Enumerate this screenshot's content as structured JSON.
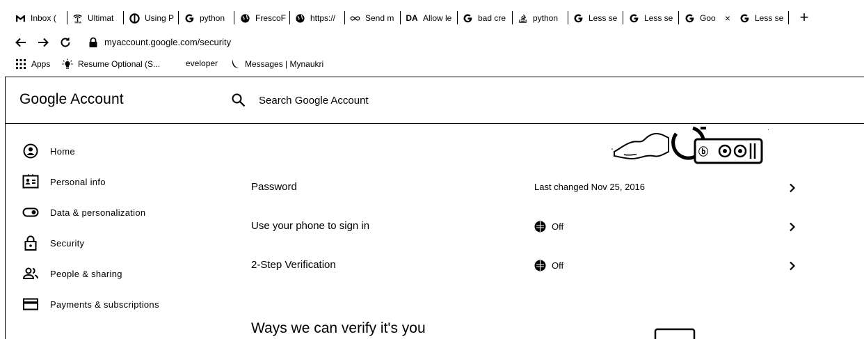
{
  "browser": {
    "tabs": [
      {
        "icon": "gmail-icon",
        "label": "Inbox (",
        "active": false
      },
      {
        "icon": "tata-icon",
        "label": "Ultimat",
        "active": false
      },
      {
        "icon": "circle-logo-icon",
        "label": "Using P",
        "active": false
      },
      {
        "icon": "google-g-icon",
        "label": "python",
        "active": false
      },
      {
        "icon": "globe-icon",
        "label": "FrescoF",
        "active": false
      },
      {
        "icon": "globe-icon",
        "label": "https://",
        "active": false
      },
      {
        "icon": "infinity-icon",
        "label": "Send m",
        "active": false
      },
      {
        "icon": "da-icon",
        "label": "Allow le",
        "active": false
      },
      {
        "icon": "google-g-icon",
        "label": "bad cre",
        "active": false
      },
      {
        "icon": "stack-icon",
        "label": "python",
        "active": false
      },
      {
        "icon": "google-g-icon",
        "label": "Less se",
        "active": false
      },
      {
        "icon": "google-g-icon",
        "label": "Less se",
        "active": false
      },
      {
        "icon": "google-g-icon",
        "label": "Goo",
        "active": true
      },
      {
        "icon": "google-g-icon",
        "label": "Less se",
        "active": false
      }
    ],
    "da_glyph": "DA",
    "close_glyph": "×",
    "newtab_glyph": "+",
    "url": "myaccount.google.com/security",
    "bookmarks": [
      {
        "icon": "apps-grid-icon",
        "label": "Apps"
      },
      {
        "icon": "bulb-icon",
        "label": "Resume Optional (S..."
      },
      {
        "icon": "",
        "label": "eveloper"
      },
      {
        "icon": "moon-icon",
        "label": "Messages | Mynaukri"
      }
    ]
  },
  "header": {
    "brand": "Google Account",
    "search_placeholder": "Search Google Account"
  },
  "sidebar": {
    "items": [
      {
        "icon": "home-icon",
        "label": "Home"
      },
      {
        "icon": "id-card-icon",
        "label": "Personal info"
      },
      {
        "icon": "toggle-icon",
        "label": "Data & personalization"
      },
      {
        "icon": "lock-icon",
        "label": "Security"
      },
      {
        "icon": "people-icon",
        "label": "People & sharing"
      },
      {
        "icon": "card-icon",
        "label": "Payments & subscriptions"
      }
    ]
  },
  "main": {
    "rows": [
      {
        "label": "Password",
        "value": "Last changed Nov 25, 2016",
        "status_icon": ""
      },
      {
        "label": "Use your phone to sign in",
        "value": "Off",
        "status_icon": "off-status-icon"
      },
      {
        "label": "2-Step Verification",
        "value": "Off",
        "status_icon": "off-status-icon"
      }
    ],
    "section_title": "Ways we can verify it's you"
  }
}
